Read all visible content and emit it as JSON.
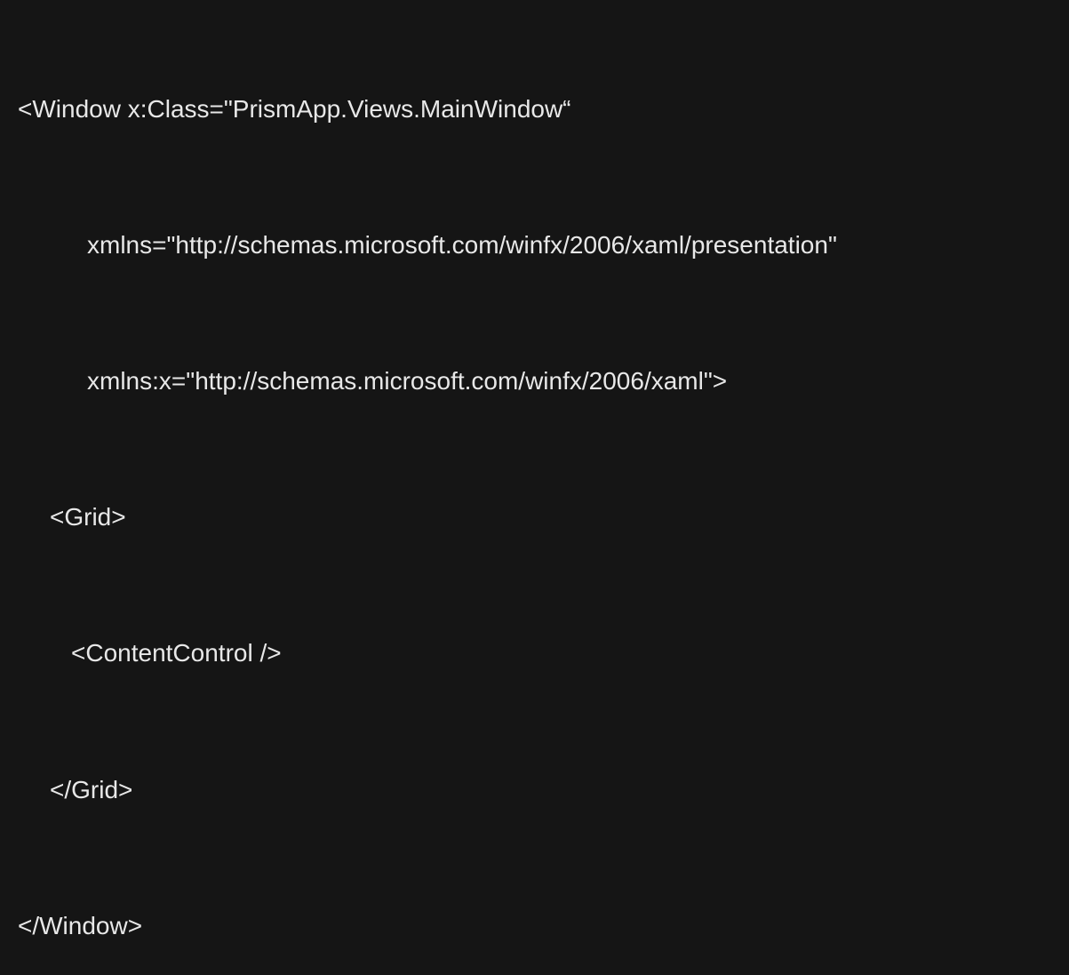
{
  "code": {
    "line1": "<Window x:Class=\"PrismApp.Views.MainWindow“",
    "line2": "xmlns=\"http://schemas.microsoft.com/winfx/2006/xaml/presentation\"",
    "line3": "xmlns:x=\"http://schemas.microsoft.com/winfx/2006/xaml\">",
    "line4": "<Grid>",
    "line5": "<ContentControl />",
    "line6": "</Grid>",
    "line7": "</Window>"
  }
}
